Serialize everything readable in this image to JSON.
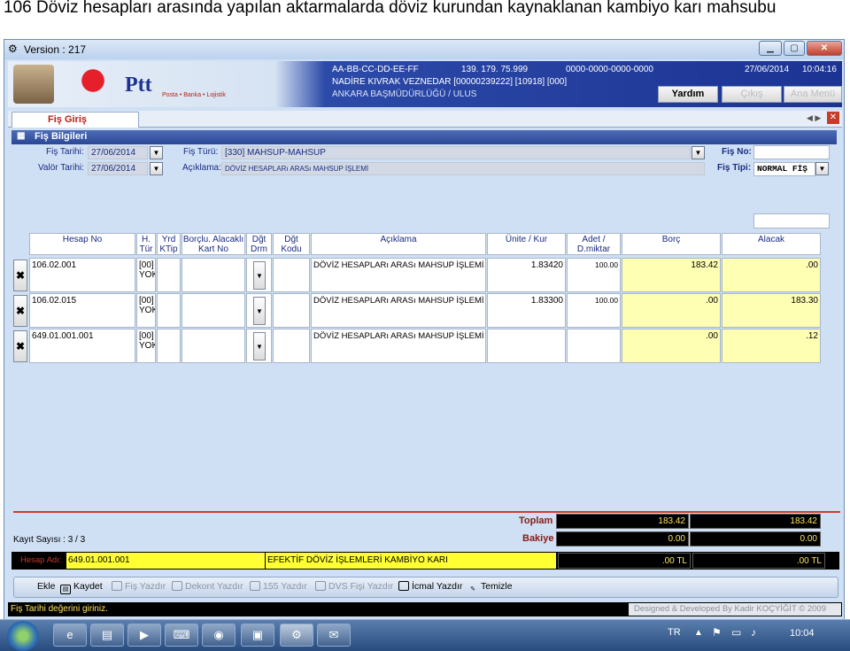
{
  "doc_title": "106 Döviz hesapları arasında yapılan aktarmalarda döviz kurundan kaynaklanan kambiyo karı mahsubu",
  "window": {
    "title": "Version : 217",
    "min_icon": "minimize-icon",
    "max_icon": "maximize-icon",
    "close_icon": "close-icon"
  },
  "banner": {
    "logo": "Ptt",
    "logo_sub": "Posta • Banka • Lojistik",
    "mac": "AA-BB-CC-DD-EE-FF",
    "ip": "139. 179. 75.999",
    "serial": "0000-0000-0000-0000",
    "date": "27/06/2014",
    "time": "10:04:16",
    "user": "NADİRE KIVRAK VEZNEDAR [00000239222] [10918] [000]",
    "office": "ANKARA BAŞMÜDÜRLÜĞÜ / ULUS",
    "help_btn": "Yardım",
    "exit_btn": "Çıkış",
    "main_btn": "Ana Menü"
  },
  "tab": {
    "label": "Fiş Giriş",
    "nav": "◀ ▶",
    "close": "✕"
  },
  "panel": {
    "title": "Fiş Bilgileri",
    "fis_tarihi_label": "Fiş Tarihi:",
    "fis_tarihi": "27/06/2014",
    "valor_tarihi_label": "Valör Tarihi:",
    "valor_tarihi": "27/06/2014",
    "fis_turu_label": "Fiş Türü:",
    "fis_turu": "[330] MAHSUP-MAHSUP",
    "aciklama_label": "Açıklama:",
    "aciklama": "DÖVİZ HESAPLARı ARASı MAHSUP İŞLEMİ",
    "fis_no_label": "Fiş No:",
    "fis_no": "",
    "fis_tipi_label": "Fiş Tipi:",
    "fis_tipi": "NORMAL FİŞ"
  },
  "table": {
    "headers": [
      {
        "l1": "Hesap No",
        "l2": ""
      },
      {
        "l1": "H.",
        "l2": "Tür"
      },
      {
        "l1": "Yrd",
        "l2": "KTip"
      },
      {
        "l1": "Borçlu. Alacaklı",
        "l2": "Kart No"
      },
      {
        "l1": "Dğt",
        "l2": "Drm"
      },
      {
        "l1": "Dğt",
        "l2": "Kodu"
      },
      {
        "l1": "Açıklama",
        "l2": ""
      },
      {
        "l1": "Ünite / Kur",
        "l2": ""
      },
      {
        "l1": "Adet /",
        "l2": "D.miktar"
      },
      {
        "l1": "Borç",
        "l2": ""
      },
      {
        "l1": "Alacak",
        "l2": ""
      }
    ],
    "rows": [
      {
        "del": "✖",
        "hesap": "106.02.001",
        "tur1": "[00]",
        "tur2": "YOK",
        "ktip": "",
        "kart": "",
        "drm": "▼",
        "kodu": "",
        "aciklama": "DÖVİZ HESAPLARı ARASı MAHSUP İŞLEMİ",
        "kur": "1.83420",
        "adet": "100.00",
        "borc": "183.42",
        "alacak": ".00"
      },
      {
        "del": "✖",
        "hesap": "106.02.015",
        "tur1": "[00]",
        "tur2": "YOK",
        "ktip": "",
        "kart": "",
        "drm": "▼",
        "kodu": "",
        "aciklama": "DÖVİZ HESAPLARı ARASı MAHSUP İŞLEMİ",
        "kur": "1.83300",
        "adet": "100.00",
        "borc": ".00",
        "alacak": "183.30"
      },
      {
        "del": "✖",
        "hesap": "649.01.001.001",
        "tur1": "[00]",
        "tur2": "YOK",
        "ktip": "",
        "kart": "",
        "drm": "▼",
        "kodu": "",
        "aciklama": "DÖVİZ HESAPLARı ARASı MAHSUP İŞLEMİ",
        "kur": "",
        "adet": "",
        "borc": ".00",
        "alacak": ".12"
      }
    ]
  },
  "totals": {
    "kayit": "Kayıt Sayısı : 3 / 3",
    "toplam_label": "Toplam",
    "toplam_borc": "183.42",
    "toplam_alacak": "183.42",
    "bakiye_label": "Bakiye",
    "bakiye_borc": "0.00",
    "bakiye_alacak": "0.00",
    "hesap_adi_label": "Hesap Adı:",
    "hesap_kodu": "649.01.001.001",
    "hesap_adi": "EFEKTİF DÖVİZ İŞLEMLERİ KAMBİYO KARI",
    "tl_borc": ".00 TL",
    "tl_alacak": ".00 TL"
  },
  "toolbar": {
    "ekle": "Ekle",
    "kaydet": "Kaydet",
    "fis_yazdir": "Fiş Yazdır",
    "dekont": "Dekont Yazdır",
    "yazdir155": "155 Yazdır",
    "dvs": "DVS Fişi Yazdır",
    "icmal": "İcmal Yazdır",
    "temizle": "Temizle"
  },
  "status": {
    "message": "Fiş Tarihi değerini giriniz.",
    "credit": "Designed & Developed By Kadir KOÇYİĞİT © 2009"
  },
  "taskbar": {
    "lang": "TR",
    "clock": "10:04"
  },
  "colors": {
    "accent": "#2b4797",
    "yellow_cell": "#ffffb4",
    "total_text": "#ffe45b",
    "red": "#d23a2c"
  }
}
